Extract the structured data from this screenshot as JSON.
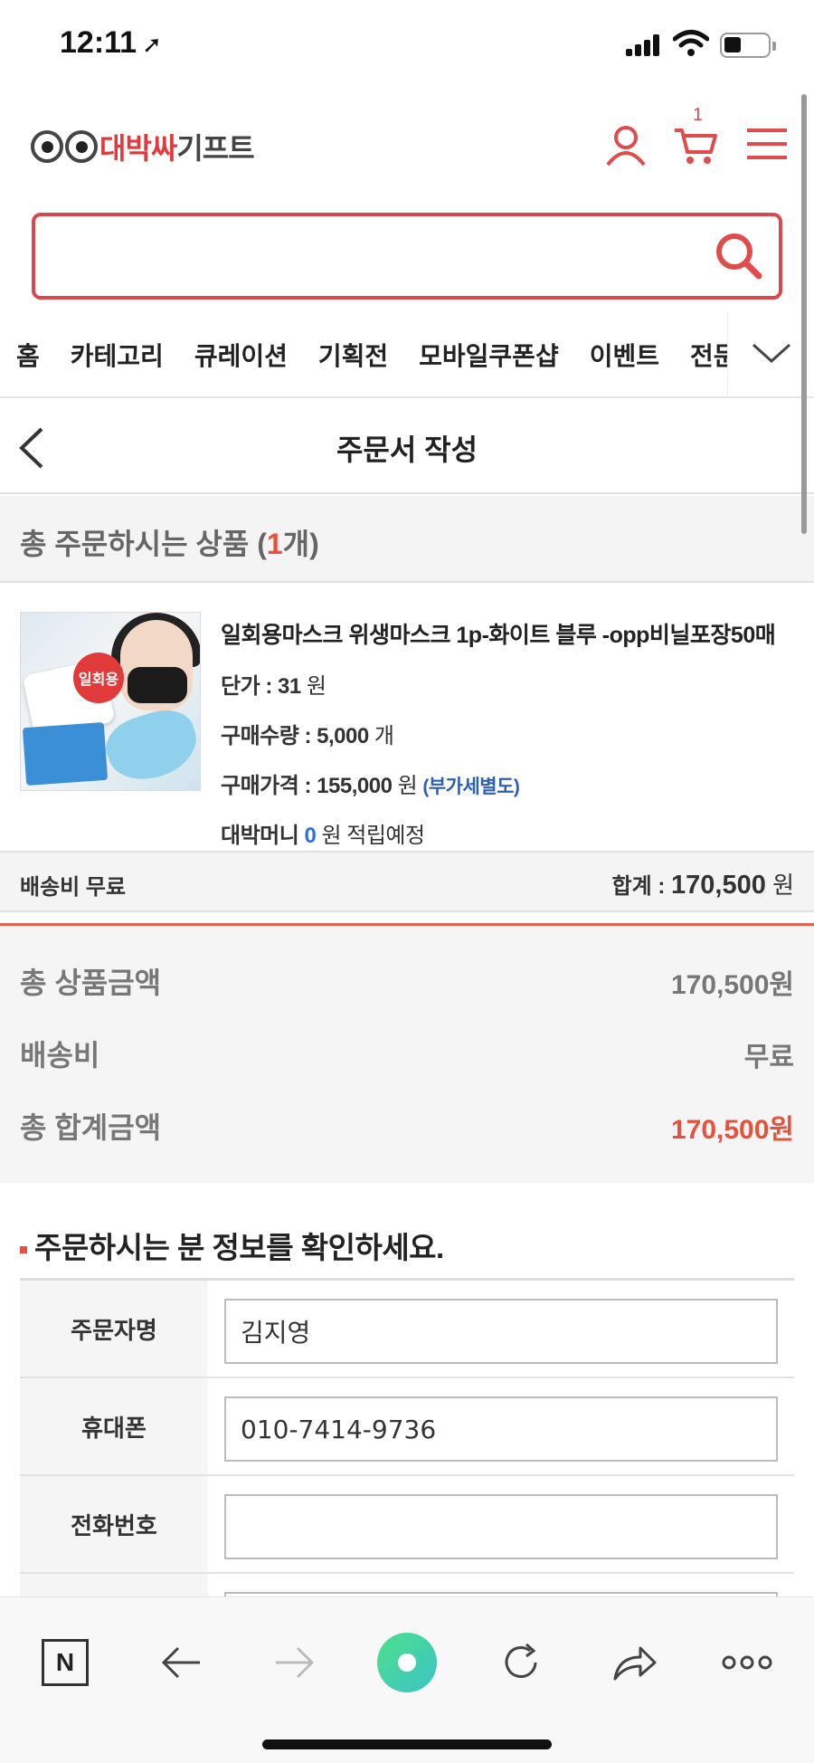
{
  "status_bar": {
    "time": "12:11"
  },
  "header": {
    "logo_brand_red": "대박싸",
    "logo_brand_gray": "기프트",
    "cart_count": "1"
  },
  "search": {
    "placeholder": ""
  },
  "nav": {
    "items": [
      "홈",
      "카테고리",
      "큐레이션",
      "기획전",
      "모바일쿠폰샵",
      "이벤트",
      "전문기"
    ]
  },
  "page": {
    "title": "주문서 작성"
  },
  "order_count": {
    "prefix": "총 주문하시는 상품 (",
    "count": "1",
    "suffix": "개)"
  },
  "product": {
    "name": "일회용마스크 위생마스크 1p-화이트 블루 -opp비닐포장50매",
    "thumb_badge": "일회용",
    "unit_price_label": "단가 : ",
    "unit_price": "31",
    "unit_price_unit": " 원",
    "qty_label": "구매수량 : ",
    "qty": "5,000",
    "qty_unit": " 개",
    "price_label": "구매가격 : ",
    "price": "155,000",
    "price_unit": " 원 ",
    "vat_note": "(부가세별도)",
    "money_label": "대박머니 ",
    "money_value": "0",
    "money_suffix": " 원 적립예정"
  },
  "summary_row": {
    "shipping": "배송비 무료",
    "sum_label": "합계 : ",
    "sum_value": "170,500",
    "sum_unit": " 원"
  },
  "totals": {
    "product_total_label": "총 상품금액",
    "product_total_value": "170,500원",
    "shipping_label": "배송비",
    "shipping_value": "무료",
    "grand_total_label": "총 합계금액",
    "grand_total_value": "170,500원",
    "accent_color": "#e5533d"
  },
  "buyer": {
    "section_title": "주문하시는 분 정보를 확인하세요.",
    "fields": [
      {
        "label": "주문자명",
        "value": "김지영"
      },
      {
        "label": "휴대폰",
        "value": "010-7414-9736"
      },
      {
        "label": "전화번호",
        "value": ""
      }
    ]
  },
  "toolbar": {
    "n_label": "N"
  }
}
